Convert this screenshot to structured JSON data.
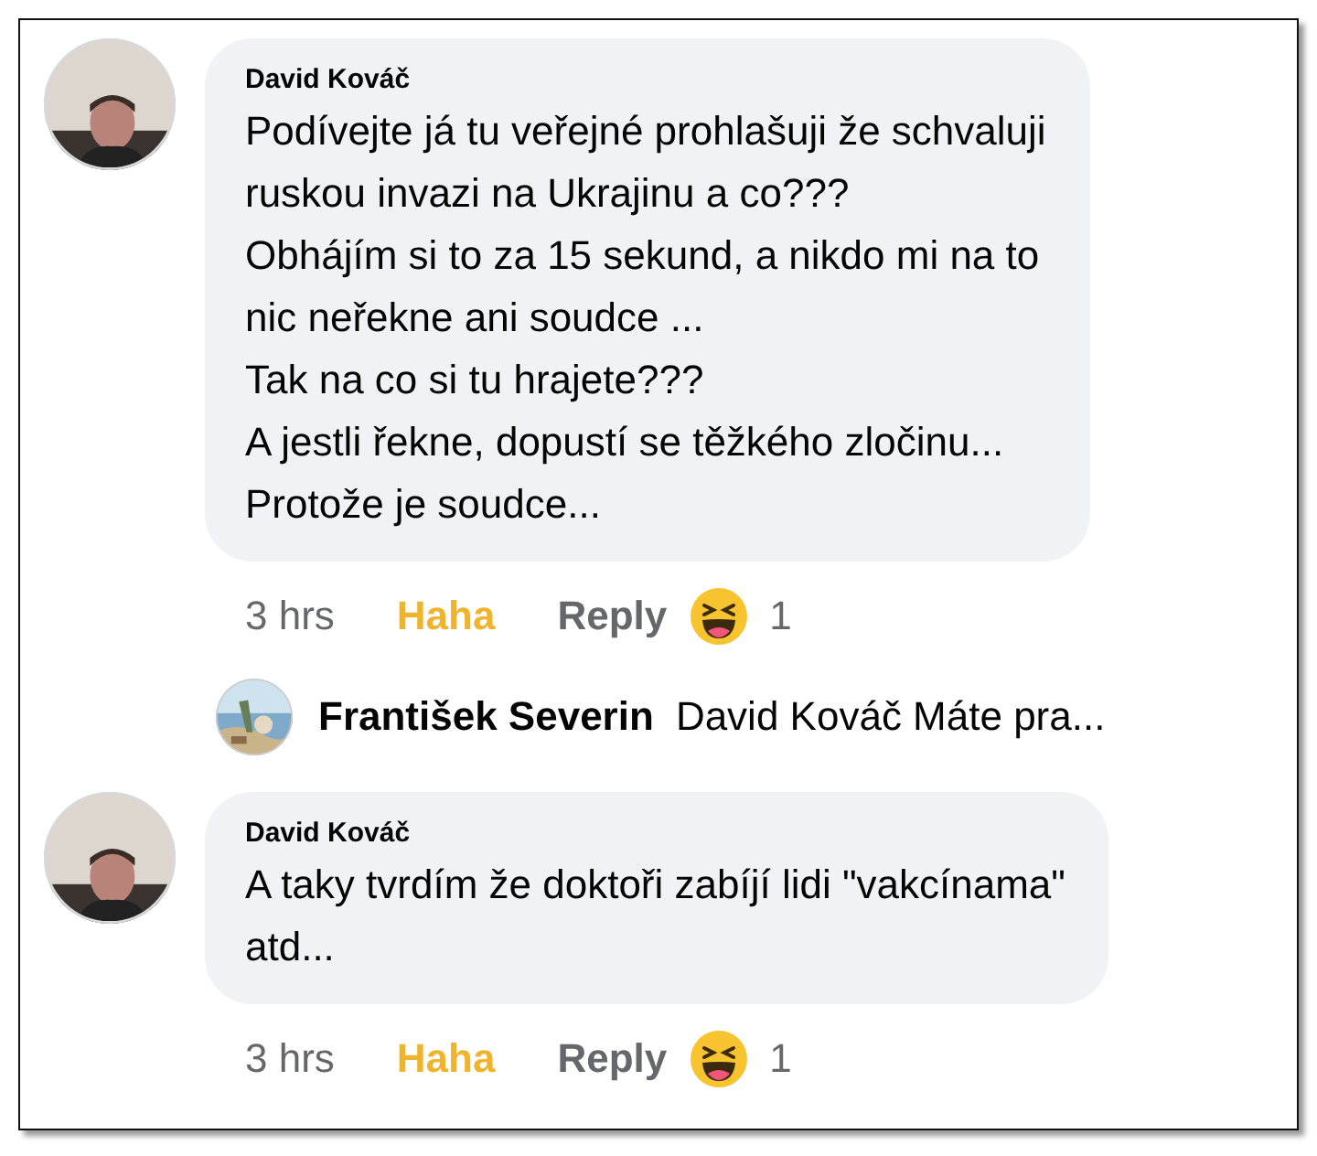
{
  "comments": [
    {
      "author": "David Kováč",
      "text": "Podívejte já tu veřejné prohlašuji že schvaluji\nruskou invazi na Ukrajinu a co???\nObhájím si to za 15 sekund, a nikdo mi na to\nnic neřekne ani soudce ...\nTak na co si tu hrajete???\nA jestli řekne, dopustí se těžkého zločinu...\nProtože je soudce...",
      "time": "3 hrs",
      "reaction": {
        "label": "Haha",
        "active": true
      },
      "reply_label": "Reply",
      "reaction_count": "1",
      "replies": [
        {
          "author": "František Severin",
          "preview": "David Kováč Máte pra..."
        }
      ]
    },
    {
      "author": "David Kováč",
      "text": "A taky tvrdím že doktoři zabíjí lidi \"vakcínama\"\natd...",
      "time": "3 hrs",
      "reaction": {
        "label": "Haha",
        "active": true
      },
      "reply_label": "Reply",
      "reaction_count": "1"
    }
  ]
}
